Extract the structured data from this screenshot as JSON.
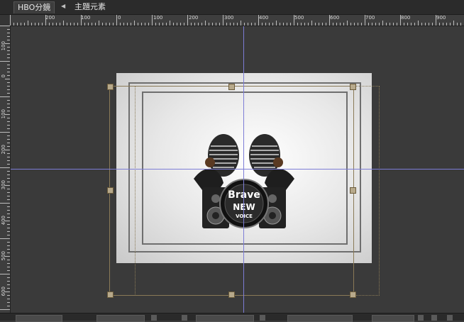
{
  "tabs": [
    {
      "label": "HBO分鏡"
    },
    {
      "label": "主題元素"
    }
  ],
  "ruler_h_labels": [
    "200",
    "100",
    "0",
    "100",
    "200",
    "300",
    "400",
    "500",
    "600",
    "700",
    "800",
    "900"
  ],
  "ruler_v_labels": [
    "100",
    "0",
    "100",
    "200",
    "300",
    "400",
    "500",
    "600"
  ],
  "logo": {
    "line1": "Brave",
    "line2": "NEW",
    "line3": "VOICE"
  },
  "colors": {
    "guide": "#7d7dd6",
    "selection": "#8a7a57",
    "background": "#3a3a3a"
  }
}
